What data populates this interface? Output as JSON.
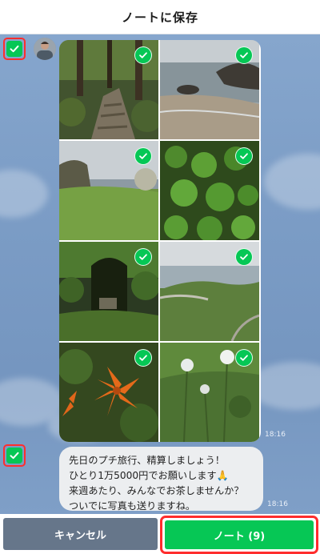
{
  "header": {
    "title": "ノートに保存"
  },
  "photo_message": {
    "timestamp": "18:16",
    "photos": [
      {
        "icon": "forest-stone-path-photo",
        "selected": true
      },
      {
        "icon": "rocky-shore-photo",
        "selected": true
      },
      {
        "icon": "coastal-cliff-meadow-photo",
        "selected": true
      },
      {
        "icon": "green-plants-photo",
        "selected": true
      },
      {
        "icon": "jungle-cave-photo",
        "selected": true
      },
      {
        "icon": "sea-view-hill-photo",
        "selected": true
      },
      {
        "icon": "orange-lily-photo",
        "selected": true
      },
      {
        "icon": "white-wildflowers-photo",
        "selected": true
      }
    ]
  },
  "text_message": {
    "lines": [
      "先日のプチ旅行、精算しましょう！",
      "ひとり1万5000円でお願いします🙏",
      "来週あたり、みんなでお茶しませんか？",
      "ついでに写真も送りますね。"
    ],
    "timestamp": "18:16"
  },
  "footer": {
    "cancel_label": "キャンセル",
    "note_label": "ノート (9)"
  },
  "colors": {
    "accent_green": "#06c755",
    "highlight_red": "#ff2d2d",
    "cancel_gray": "#66768a",
    "chat_background": "#7d9fc7"
  }
}
